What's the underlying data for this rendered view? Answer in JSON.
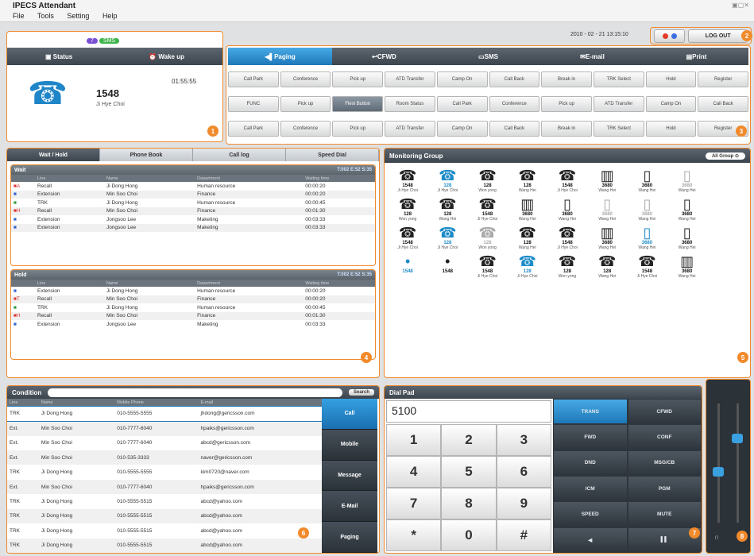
{
  "app": {
    "title": "IPECS Attendant",
    "window_controls": "▣▢✕"
  },
  "menu": [
    "File",
    "Tools",
    "Setting",
    "Help"
  ],
  "header": {
    "datetime": "2010 - 02 - 21 13:15:10",
    "logout_label": "LOG OUT",
    "dot_colors": [
      "#e23b2a",
      "#3b6fe2"
    ]
  },
  "status_panel": {
    "status_label": "Status",
    "wakeup_label": "Wake up",
    "bubble1": "7",
    "bubble2": "SMS",
    "timer": "01:55:55",
    "extension": "1548",
    "name": "Ji Hye Choi"
  },
  "func_tabs": [
    "Paging",
    "CFWD",
    "SMS",
    "E-mail",
    "Print"
  ],
  "func_rows": [
    [
      "Call Park",
      "Conference",
      "Pick up",
      "ATD Transfer",
      "Camp On",
      "Call Back",
      "Break in",
      "TRK Select",
      "Hold",
      "Register"
    ],
    [
      "FUNC",
      "Pick up",
      "Flexi Button",
      "Room Status",
      "Call Park",
      "Conference",
      "Pick up",
      "ATD Transfer",
      "Camp On",
      "Call Back"
    ],
    [
      "Call Park",
      "Conference",
      "Pick up",
      "ATD Transfer",
      "Camp On",
      "Call Back",
      "Break in",
      "TRK Select",
      "Hold",
      "Register"
    ]
  ],
  "wait_panel": {
    "tabs": [
      "Wait / Hold",
      "Phone Book",
      "Call log",
      "Speed Dial"
    ],
    "wait_title": "Wait",
    "wait_meta": "T:002  E:52  S:35",
    "columns": [
      "",
      "Line",
      "Name",
      "Department",
      "Waiting time"
    ],
    "wait_rows": [
      {
        "mark": "■A",
        "line": "Recall",
        "name": "Ji Dong Hong",
        "dept": "Human resource",
        "time": "00:00:20",
        "color": "#d33"
      },
      {
        "mark": "■",
        "line": "Extension",
        "name": "Min Soo Choi",
        "dept": "Finance",
        "time": "00:00:20",
        "color": "#2f5fd0"
      },
      {
        "mark": "■",
        "line": "TRK",
        "name": "Ji Dong Hong",
        "dept": "Human resource",
        "time": "00:00:45",
        "color": "#2a9a3a"
      },
      {
        "mark": "■H",
        "line": "Recall",
        "name": "Min Soo Choi",
        "dept": "Finance",
        "time": "00:01:30",
        "color": "#d33"
      },
      {
        "mark": "■",
        "line": "Extension",
        "name": "Jongsoo Lee",
        "dept": "Maketing",
        "time": "00:03:33",
        "color": "#2f5fd0"
      },
      {
        "mark": "■",
        "line": "Extension",
        "name": "Jongsoo Lee",
        "dept": "Maketing",
        "time": "00:03:33",
        "color": "#2f5fd0"
      }
    ],
    "hold_title": "Hold",
    "hold_meta": "T:002  E:52  S:35",
    "hold_rows": [
      {
        "mark": "■",
        "line": "Extension",
        "name": "Ji Dong Hong",
        "dept": "Human resource",
        "time": "00:00:20",
        "color": "#2f5fd0"
      },
      {
        "mark": "■T",
        "line": "Recall",
        "name": "Min Soo Choi",
        "dept": "Finance",
        "time": "00:00:20",
        "color": "#d33"
      },
      {
        "mark": "■",
        "line": "TRK",
        "name": "Ji Dong Hong",
        "dept": "Human resource",
        "time": "00:00:45",
        "color": "#2a9a3a"
      },
      {
        "mark": "■H",
        "line": "Recall",
        "name": "Min Soo Choi",
        "dept": "Finance",
        "time": "00:01:30",
        "color": "#d33"
      },
      {
        "mark": "■",
        "line": "Extension",
        "name": "Jongsoo Lee",
        "dept": "Maketing",
        "time": "00:03:33",
        "color": "#2f5fd0"
      }
    ]
  },
  "monitor": {
    "title": "Monitoring Group",
    "group_select": "All Group",
    "cells": [
      {
        "ic": "☎",
        "nm": "1548",
        "sub": "Ji Hye Choi",
        "style": ""
      },
      {
        "ic": "☎",
        "nm": "128",
        "sub": "Ji Hye Choi",
        "style": "blue"
      },
      {
        "ic": "☎",
        "nm": "128",
        "sub": "Won yong",
        "style": ""
      },
      {
        "ic": "☎",
        "nm": "128",
        "sub": "Wang Hei",
        "style": ""
      },
      {
        "ic": "☎",
        "nm": "1548",
        "sub": "Ji Hye Choi",
        "style": ""
      },
      {
        "ic": "▥",
        "nm": "3680",
        "sub": "Wang Hei",
        "style": ""
      },
      {
        "ic": "▯",
        "nm": "3680",
        "sub": "Wang Hei",
        "style": ""
      },
      {
        "ic": "▯",
        "nm": "3680",
        "sub": "Wang Hei",
        "style": "grey"
      },
      {
        "ic": "",
        "nm": "",
        "sub": "",
        "style": ""
      },
      {
        "ic": "☎",
        "nm": "128",
        "sub": "Won yong",
        "style": ""
      },
      {
        "ic": "☎",
        "nm": "128",
        "sub": "Wang Hei",
        "style": ""
      },
      {
        "ic": "☎",
        "nm": "1548",
        "sub": "Ji Hye Choi",
        "style": ""
      },
      {
        "ic": "▥",
        "nm": "3680",
        "sub": "Wang Hei",
        "style": ""
      },
      {
        "ic": "▯",
        "nm": "3680",
        "sub": "Wang Hei",
        "style": ""
      },
      {
        "ic": "▯",
        "nm": "3680",
        "sub": "Wang Hei",
        "style": "grey"
      },
      {
        "ic": "▯",
        "nm": "3680",
        "sub": "Wang Hei",
        "style": "grey"
      },
      {
        "ic": "▯",
        "nm": "3680",
        "sub": "Wang Hei",
        "style": ""
      },
      {
        "ic": "",
        "nm": "",
        "sub": "",
        "style": ""
      },
      {
        "ic": "☎",
        "nm": "1548",
        "sub": "Ji Hye Choi",
        "style": ""
      },
      {
        "ic": "☎",
        "nm": "128",
        "sub": "Ji Hye Choi",
        "style": "blue"
      },
      {
        "ic": "☎",
        "nm": "128",
        "sub": "Won yong",
        "style": "grey"
      },
      {
        "ic": "☎",
        "nm": "128",
        "sub": "Wang Hei",
        "style": ""
      },
      {
        "ic": "☎",
        "nm": "1548",
        "sub": "Ji Hye Choi",
        "style": ""
      },
      {
        "ic": "▥",
        "nm": "3680",
        "sub": "Wang Hei",
        "style": ""
      },
      {
        "ic": "▯",
        "nm": "3680",
        "sub": "Wang Hei",
        "style": "blue"
      },
      {
        "ic": "▯",
        "nm": "3680",
        "sub": "Wang Hei",
        "style": ""
      },
      {
        "ic": "",
        "nm": "",
        "sub": "",
        "style": ""
      },
      {
        "ic": "•",
        "nm": "1548",
        "sub": "",
        "style": "blue"
      },
      {
        "ic": "•",
        "nm": "1548",
        "sub": "",
        "style": ""
      },
      {
        "ic": "☎",
        "nm": "1548",
        "sub": "Ji Hye Choi",
        "style": ""
      },
      {
        "ic": "☎",
        "nm": "128",
        "sub": "Ji Hye Choi",
        "style": "blue"
      },
      {
        "ic": "☎",
        "nm": "128",
        "sub": "Won yong",
        "style": ""
      },
      {
        "ic": "☎",
        "nm": "128",
        "sub": "Wang Hei",
        "style": ""
      },
      {
        "ic": "☎",
        "nm": "1548",
        "sub": "Ji Hye Choi",
        "style": ""
      },
      {
        "ic": "▥",
        "nm": "3680",
        "sub": "Wang Hei",
        "style": ""
      },
      {
        "ic": "",
        "nm": "",
        "sub": "",
        "style": ""
      }
    ]
  },
  "phonebook": {
    "title": "Condition",
    "search_label": "Search",
    "columns": [
      "Line",
      "Name",
      "Mobile Phone",
      "E-mail"
    ],
    "rows": [
      [
        "TRK",
        "Ji Dong Hong",
        "010-5555-5555",
        "jhdong@gericsson.com"
      ],
      [
        "Ext.",
        "Min Soo Choi",
        "010-7777-6040",
        "hpaiks@gericsson.com"
      ],
      [
        "Ext.",
        "Min Soo Choi",
        "010-7777-6040",
        "abcd@gericsson.com"
      ],
      [
        "Ext.",
        "Min Soo Choi",
        "010-535-3333",
        "naver@gericsson.com"
      ],
      [
        "TRK",
        "Ji Dong Hong",
        "010-5555-5555",
        "kim0720@naver.com"
      ],
      [
        "Ext.",
        "Min Soo Choi",
        "010-7777-6040",
        "hpaiks@gericsson.com"
      ],
      [
        "TRK",
        "Ji Dong Hong",
        "010-5555-5515",
        "abcd@yahoo.com"
      ],
      [
        "TRK",
        "Ji Dong Hong",
        "010-5555-5515",
        "abcd@yahoo.com"
      ],
      [
        "TRK",
        "Ji Dong Hong",
        "010-5555-5515",
        "abcd@yahoo.com"
      ],
      [
        "TRK",
        "Ji Dong Hong",
        "010-5555-5515",
        "abcd@yahoo.com"
      ]
    ],
    "actions": [
      "Call",
      "Mobile",
      "Message",
      "E-Mail",
      "Paging"
    ]
  },
  "dialpad": {
    "title": "Dial Pad",
    "value": "5100",
    "keys": [
      "1",
      "2",
      "3",
      "4",
      "5",
      "6",
      "7",
      "8",
      "9",
      "*",
      "0",
      "#"
    ],
    "functions": [
      "TRANS",
      "CFWD",
      "FWD",
      "CONF",
      "DND",
      "MSG/CB",
      "ICM",
      "PGM",
      "SPEED",
      "MUTE",
      "◀",
      "▌▌"
    ]
  },
  "volume": {
    "left_label": "∩",
    "right_label": "●"
  },
  "badges": [
    "1",
    "2",
    "3",
    "4",
    "5",
    "6",
    "7",
    "8"
  ],
  "colors": {
    "accent": "#f08a2a",
    "selected": "#1e78b8",
    "dark": "#3c444c"
  }
}
